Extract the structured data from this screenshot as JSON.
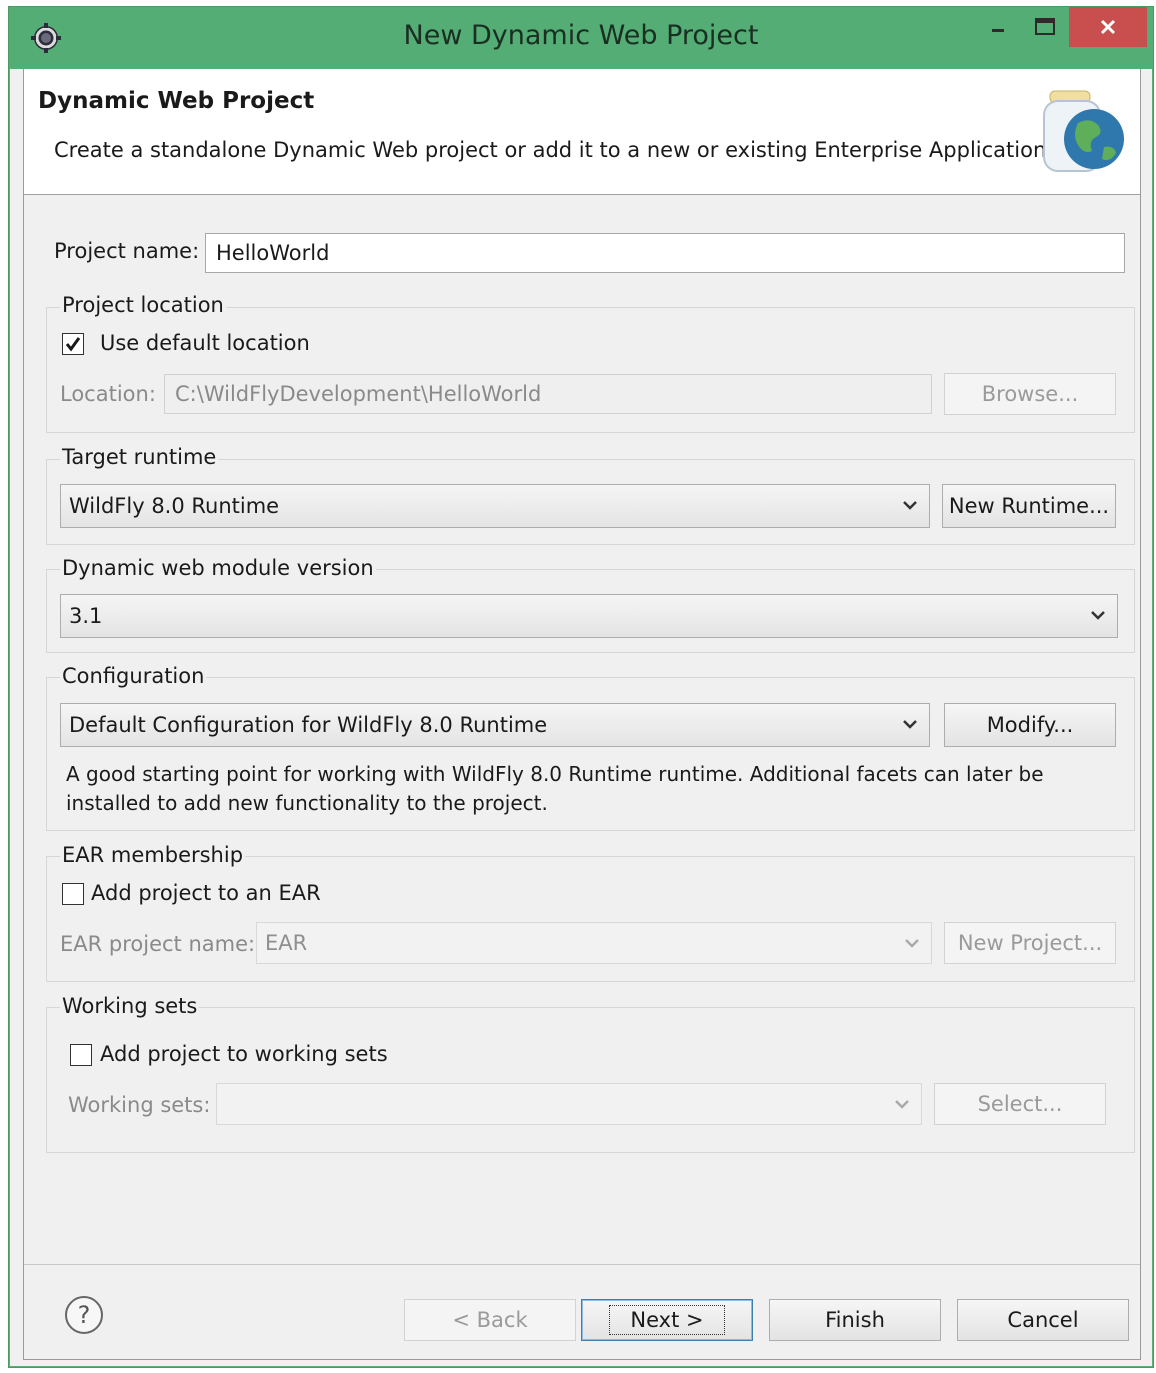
{
  "window": {
    "title": "New Dynamic Web Project"
  },
  "header": {
    "title": "Dynamic Web Project",
    "description": "Create a standalone Dynamic Web project or add it to a new or existing Enterprise Application."
  },
  "project_name": {
    "label": "Project name:",
    "value": "HelloWorld"
  },
  "project_location": {
    "group_title": "Project location",
    "use_default_label": "Use default location",
    "use_default_checked": true,
    "location_label": "Location:",
    "location_value": "C:\\WildFlyDevelopment\\HelloWorld",
    "browse_label": "Browse..."
  },
  "target_runtime": {
    "group_title": "Target runtime",
    "selected": "WildFly 8.0 Runtime",
    "new_runtime_label": "New Runtime..."
  },
  "module_version": {
    "group_title": "Dynamic web module version",
    "selected": "3.1"
  },
  "configuration": {
    "group_title": "Configuration",
    "selected": "Default Configuration for WildFly 8.0 Runtime",
    "modify_label": "Modify...",
    "description": "A good starting point for working with WildFly 8.0 Runtime runtime. Additional facets can later be installed to add new functionality to the project."
  },
  "ear_membership": {
    "group_title": "EAR membership",
    "add_label": "Add project to an EAR",
    "add_checked": false,
    "ear_name_label": "EAR project name:",
    "ear_name_value": "EAR",
    "new_project_label": "New Project..."
  },
  "working_sets": {
    "group_title": "Working sets",
    "add_label": "Add project to working sets",
    "add_checked": false,
    "sets_label": "Working sets:",
    "sets_value": "",
    "select_label": "Select..."
  },
  "footer": {
    "back_label": "< Back",
    "next_label": "Next >",
    "finish_label": "Finish",
    "cancel_label": "Cancel"
  },
  "colors": {
    "titlebar": "#54ad74",
    "close_button": "#c94e4e"
  }
}
